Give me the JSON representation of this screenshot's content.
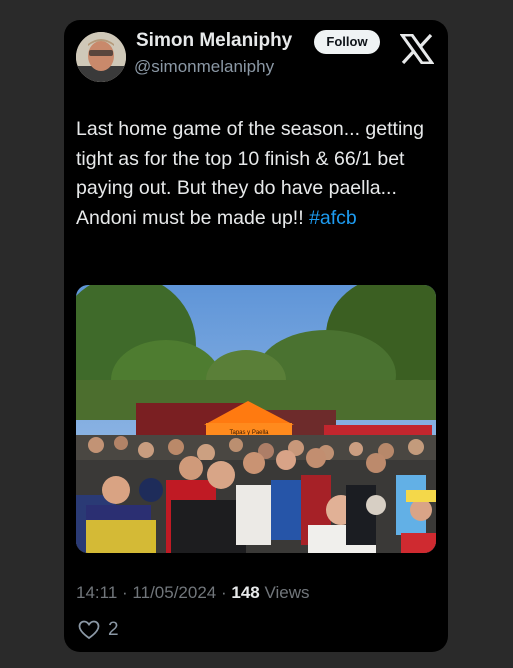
{
  "author": {
    "display_name": "Simon Melaniphy",
    "handle": "@simonmelaniphy"
  },
  "follow_label": "Follow",
  "tweet": {
    "text": "Last home game of the season... getting tight as for the top 10 finish & 66/1 bet paying out. But they do have paella... Andoni must be made up!!",
    "hashtag": "#afcb",
    "tent_sign": "Tapas y Paella"
  },
  "meta": {
    "time": "14:11",
    "date": "11/05/2024",
    "separator": "·",
    "views_count": "148",
    "views_label": "Views"
  },
  "likes": {
    "count": "2"
  },
  "icons": {
    "brand": "x-logo-icon",
    "like": "heart-icon"
  },
  "colors": {
    "background": "#000000",
    "hashtag": "#1d9bf0",
    "muted": "#71767b"
  }
}
